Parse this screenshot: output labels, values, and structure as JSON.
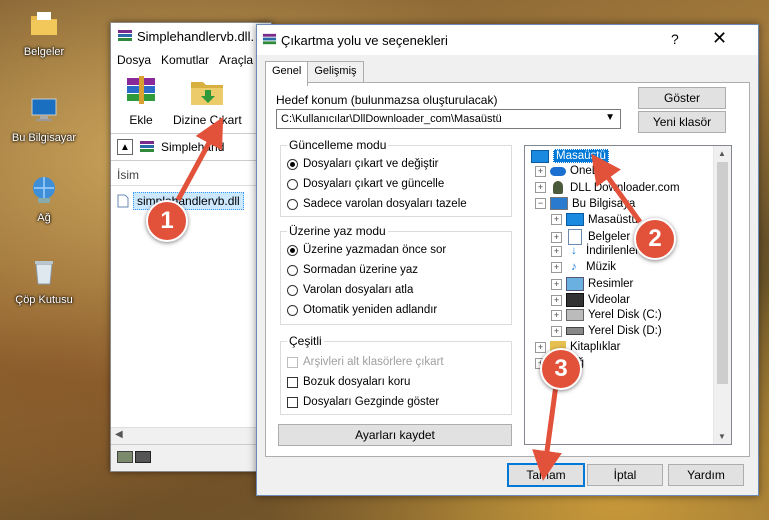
{
  "desktop": {
    "icons": [
      {
        "label": "Belgeler"
      },
      {
        "label": "Bu Bilgisayar"
      },
      {
        "label": "Ağ"
      },
      {
        "label": "Çöp Kutusu"
      }
    ]
  },
  "winrar": {
    "title": "Simplehandlervb.dll.",
    "menu": [
      "Dosya",
      "Komutlar",
      "Araçla"
    ],
    "tools": [
      {
        "label": "Ekle"
      },
      {
        "label": "Dizine Çıkart"
      }
    ],
    "path": "Simplehand",
    "column": "İsim",
    "file": "simplehandlervb.dll"
  },
  "dialog": {
    "title": "Çıkartma yolu ve seçenekleri",
    "help": "?",
    "close": "✕",
    "tabs": [
      "Genel",
      "Gelişmiş"
    ],
    "dest_label": "Hedef konum (bulunmazsa oluşturulacak)",
    "dest_value": "C:\\Kullanıcılar\\DllDownloader_com\\Masaüstü",
    "show_button": "Göster",
    "new_folder_button": "Yeni klasör",
    "update_mode": {
      "title": "Güncelleme modu",
      "options": [
        "Dosyaları çıkart ve değiştir",
        "Dosyaları çıkart ve güncelle",
        "Sadece varolan dosyaları tazele"
      ],
      "selected": 0
    },
    "overwrite_mode": {
      "title": "Üzerine yaz modu",
      "options": [
        "Üzerine yazmadan önce sor",
        "Sormadan üzerine yaz",
        "Varolan dosyaları atla",
        "Otomatik yeniden adlandır"
      ],
      "selected": 0
    },
    "misc": {
      "title": "Çeşitli",
      "options": [
        "Arşivleri alt klasörlere çıkart",
        "Bozuk dosyaları koru",
        "Dosyaları Gezginde göster"
      ]
    },
    "save_settings_button": "Ayarları kaydet",
    "tree": [
      {
        "label": "Masaüstü"
      },
      {
        "label": "OneDr"
      },
      {
        "label": "DLL Downloader.com"
      },
      {
        "label": "Bu Bilgisaya"
      },
      {
        "label": "Masaüstü"
      },
      {
        "label": "Belgeler"
      },
      {
        "label": "İndirilenler"
      },
      {
        "label": "Müzik"
      },
      {
        "label": "Resimler"
      },
      {
        "label": "Videolar"
      },
      {
        "label": "Yerel Disk (C:)"
      },
      {
        "label": "Yerel Disk (D:)"
      },
      {
        "label": "Kitaplıklar"
      },
      {
        "label": "Ağ"
      }
    ],
    "ok_button": "Tamam",
    "cancel_button": "İptal",
    "help_button": "Yardım"
  },
  "steps": [
    "1",
    "2",
    "3"
  ],
  "colors": {
    "accent": "#0078d7",
    "badge": "#e2513a"
  }
}
